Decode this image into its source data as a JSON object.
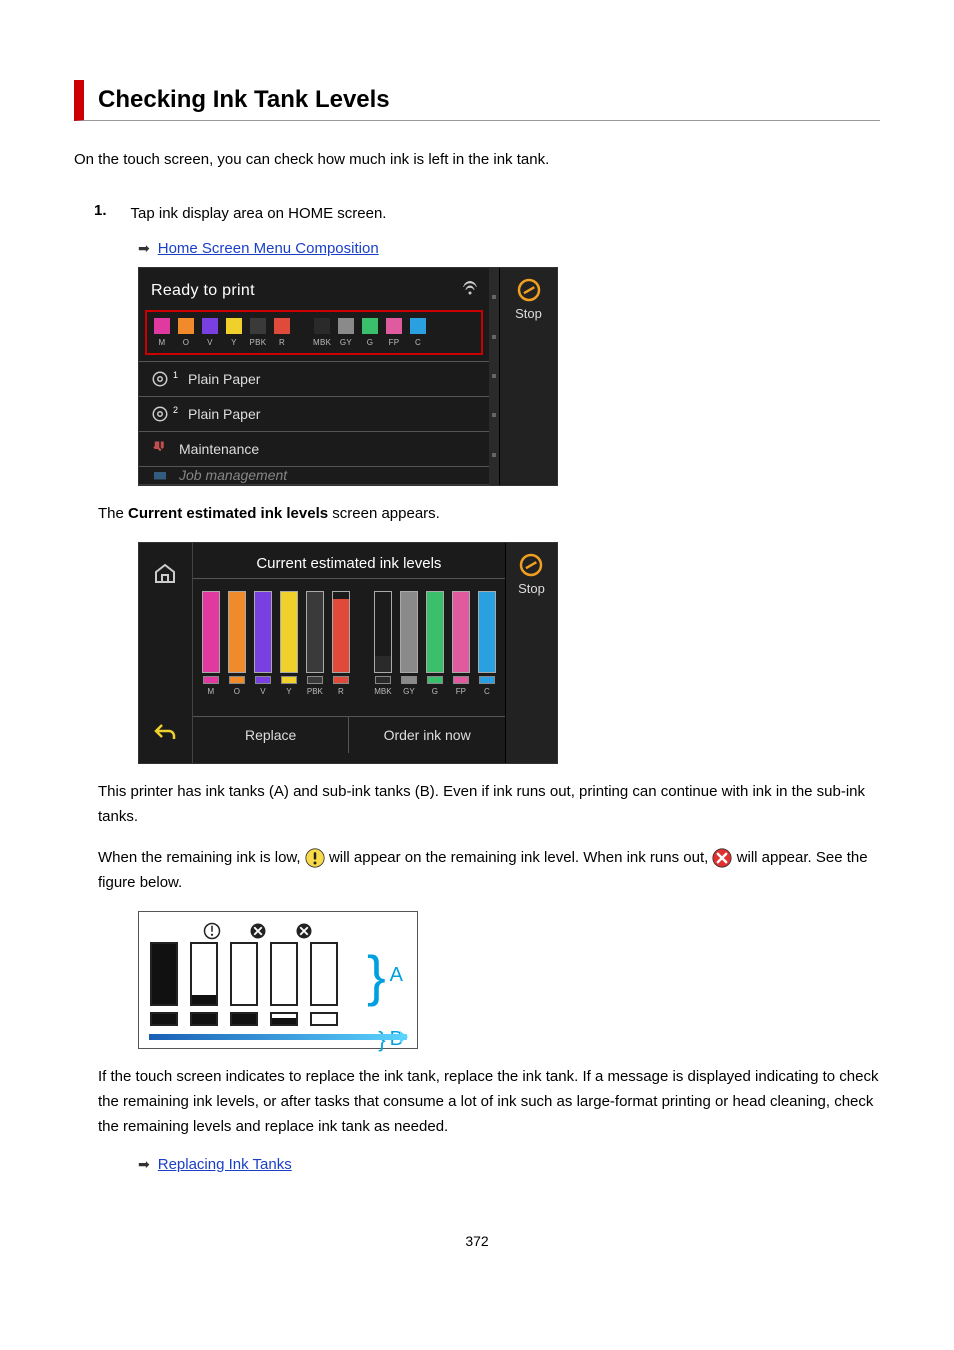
{
  "page": {
    "title": "Checking Ink Tank Levels",
    "intro": "On the touch screen, you can check how much ink is left in the ink tank.",
    "page_number": "372"
  },
  "step1": {
    "number": "1.",
    "text": "Tap ink display area on HOME screen.",
    "link1_label": "Home Screen Menu Composition",
    "after_shot1": "The Current estimated ink levels screen appears.",
    "after_shot1_bold": "Current estimated ink levels",
    "after_shot2_p1": "This printer has ink tanks (A) and sub-ink tanks (B). Even if ink runs out, printing can continue with ink in the sub-ink tanks.",
    "after_shot2_p2_a": "When the remaining ink is low, ",
    "after_shot2_p2_b": " will appear on the remaining ink level. When ink runs out, ",
    "after_shot2_p2_c": " will appear. See the figure below.",
    "closing": "If the touch screen indicates to replace the ink tank, replace the ink tank. If a message is displayed indicating to check the remaining ink levels, or after tasks that consume a lot of ink such as large-format printing or head cleaning, check the remaining levels and replace ink tank as needed.",
    "link2_label": "Replacing Ink Tanks"
  },
  "screen1": {
    "status": "Ready to print",
    "stop_label": "Stop",
    "inks_left": [
      {
        "label": "M",
        "color": "#e03aa1"
      },
      {
        "label": "O",
        "color": "#f08a2a"
      },
      {
        "label": "V",
        "color": "#7a3fe0"
      },
      {
        "label": "Y",
        "color": "#f0d02a"
      },
      {
        "label": "PBK",
        "color": "#3a3a3a"
      },
      {
        "label": "R",
        "color": "#e04a3a"
      }
    ],
    "inks_right": [
      {
        "label": "MBK",
        "color": "#2a2a2a"
      },
      {
        "label": "GY",
        "color": "#8a8a8a"
      },
      {
        "label": "G",
        "color": "#3ac06a"
      },
      {
        "label": "FP",
        "color": "#e05aa0"
      },
      {
        "label": "C",
        "color": "#2aa0e0"
      }
    ],
    "rows": [
      {
        "icon": "roll-1",
        "label": "Plain Paper"
      },
      {
        "icon": "roll-2",
        "label": "Plain Paper"
      },
      {
        "icon": "maint",
        "label": "Maintenance"
      },
      {
        "icon": "job",
        "label": "Job management"
      }
    ]
  },
  "screen2": {
    "title": "Current estimated ink levels",
    "stop_label": "Stop",
    "btn_replace": "Replace",
    "btn_order": "Order ink now",
    "left_tanks": [
      {
        "label": "M",
        "color": "#e03aa1",
        "level": 100
      },
      {
        "label": "O",
        "color": "#f08a2a",
        "level": 100
      },
      {
        "label": "V",
        "color": "#7a3fe0",
        "level": 100
      },
      {
        "label": "Y",
        "color": "#f0d02a",
        "level": 100
      },
      {
        "label": "PBK",
        "color": "#3a3a3a",
        "level": 100
      },
      {
        "label": "R",
        "color": "#e04a3a",
        "level": 92
      }
    ],
    "right_tanks": [
      {
        "label": "MBK",
        "color": "#2a2a2a",
        "level": 20
      },
      {
        "label": "GY",
        "color": "#8a8a8a",
        "level": 100
      },
      {
        "label": "G",
        "color": "#3ac06a",
        "level": 100
      },
      {
        "label": "FP",
        "color": "#e05aa0",
        "level": 100
      },
      {
        "label": "C",
        "color": "#2aa0e0",
        "level": 100
      }
    ]
  },
  "diagram": {
    "label_A": "A",
    "label_B": "B",
    "header_icons": [
      "info",
      "x",
      "x"
    ],
    "cols": [
      {
        "tank_level": 100,
        "sub_level": 100
      },
      {
        "tank_level": 15,
        "sub_level": 100
      },
      {
        "tank_level": 0,
        "sub_level": 100
      },
      {
        "tank_level": 0,
        "sub_level": 60
      },
      {
        "tank_level": 0,
        "sub_level": 0
      }
    ]
  }
}
